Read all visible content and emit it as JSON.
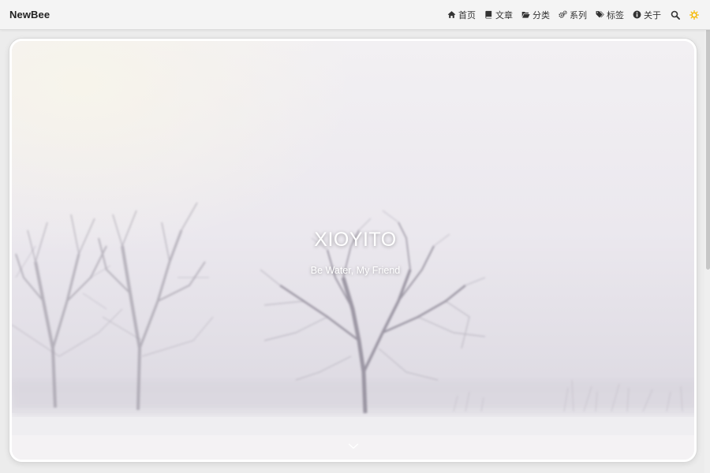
{
  "brand": "NewBee",
  "nav": {
    "items": [
      {
        "label": "首页",
        "icon": "home-icon"
      },
      {
        "label": "文章",
        "icon": "book-icon"
      },
      {
        "label": "分类",
        "icon": "folder-open-icon"
      },
      {
        "label": "系列",
        "icon": "gears-icon"
      },
      {
        "label": "标签",
        "icon": "tags-icon"
      },
      {
        "label": "关于",
        "icon": "info-circle-icon"
      }
    ],
    "search_icon": "search-icon",
    "theme_icon": "sun-icon"
  },
  "hero": {
    "title": "XIOYITO",
    "subtitle": "Be Water, My Friend",
    "scroll_icon": "chevron-down-icon"
  },
  "colors": {
    "theme_toggle": "#f5b800",
    "nav_text": "#333333",
    "navbar_bg": "#f4f4f4"
  }
}
